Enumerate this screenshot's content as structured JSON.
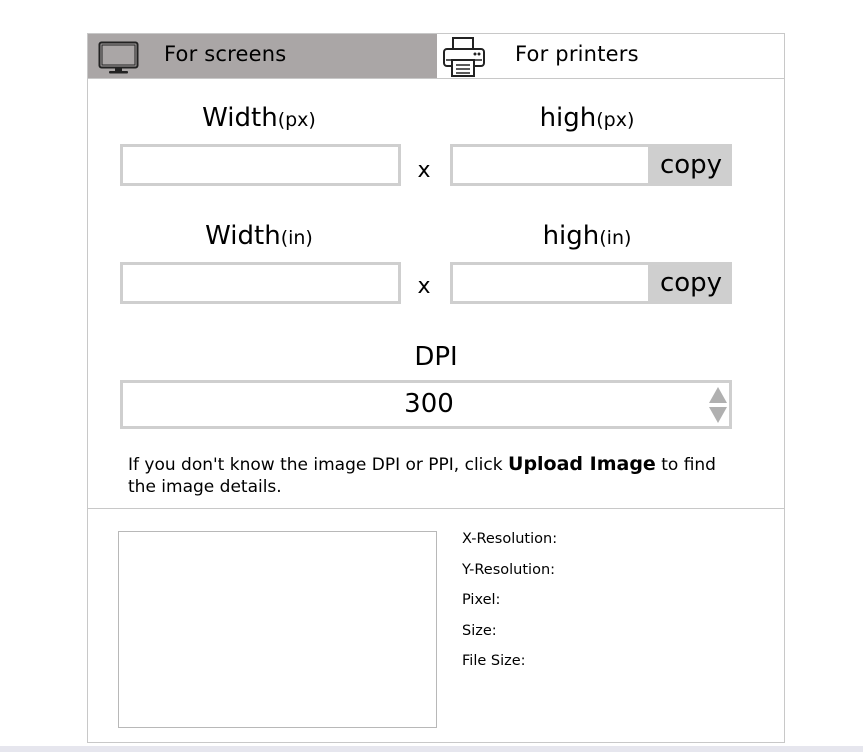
{
  "tabs": {
    "screens_label": "For screens",
    "printers_label": "For printers",
    "active": "screens",
    "active_color": "#aaa6a6",
    "screens_icon": "monitor-icon",
    "printers_icon": "printer-icon"
  },
  "pixels": {
    "width_label": "Width",
    "width_unit": "(px)",
    "height_label": "high",
    "height_unit": "(px)",
    "width_value": "",
    "height_value": "",
    "times": "x",
    "copy_label": "copy"
  },
  "inches": {
    "width_label": "Width",
    "width_unit": "(in)",
    "height_label": "high",
    "height_unit": "(in)",
    "width_value": "",
    "height_value": "",
    "times": "x",
    "copy_label": "copy"
  },
  "dpi": {
    "label": "DPI",
    "value": "300",
    "spinner_icons": [
      "triangle-up-icon",
      "triangle-down-icon"
    ]
  },
  "hint": {
    "prefix": "If you don't know the image DPI or PPI, click ",
    "link": "Upload Image",
    "suffix": " to find the image details."
  },
  "details": {
    "x_resolution": "X-Resolution:",
    "y_resolution": "Y-Resolution:",
    "pixel": "Pixel:",
    "size": "Size:",
    "file_size": "File Size:"
  },
  "colors": {
    "border": "#cfcfcf",
    "copy_bg": "#cfcfcf"
  }
}
